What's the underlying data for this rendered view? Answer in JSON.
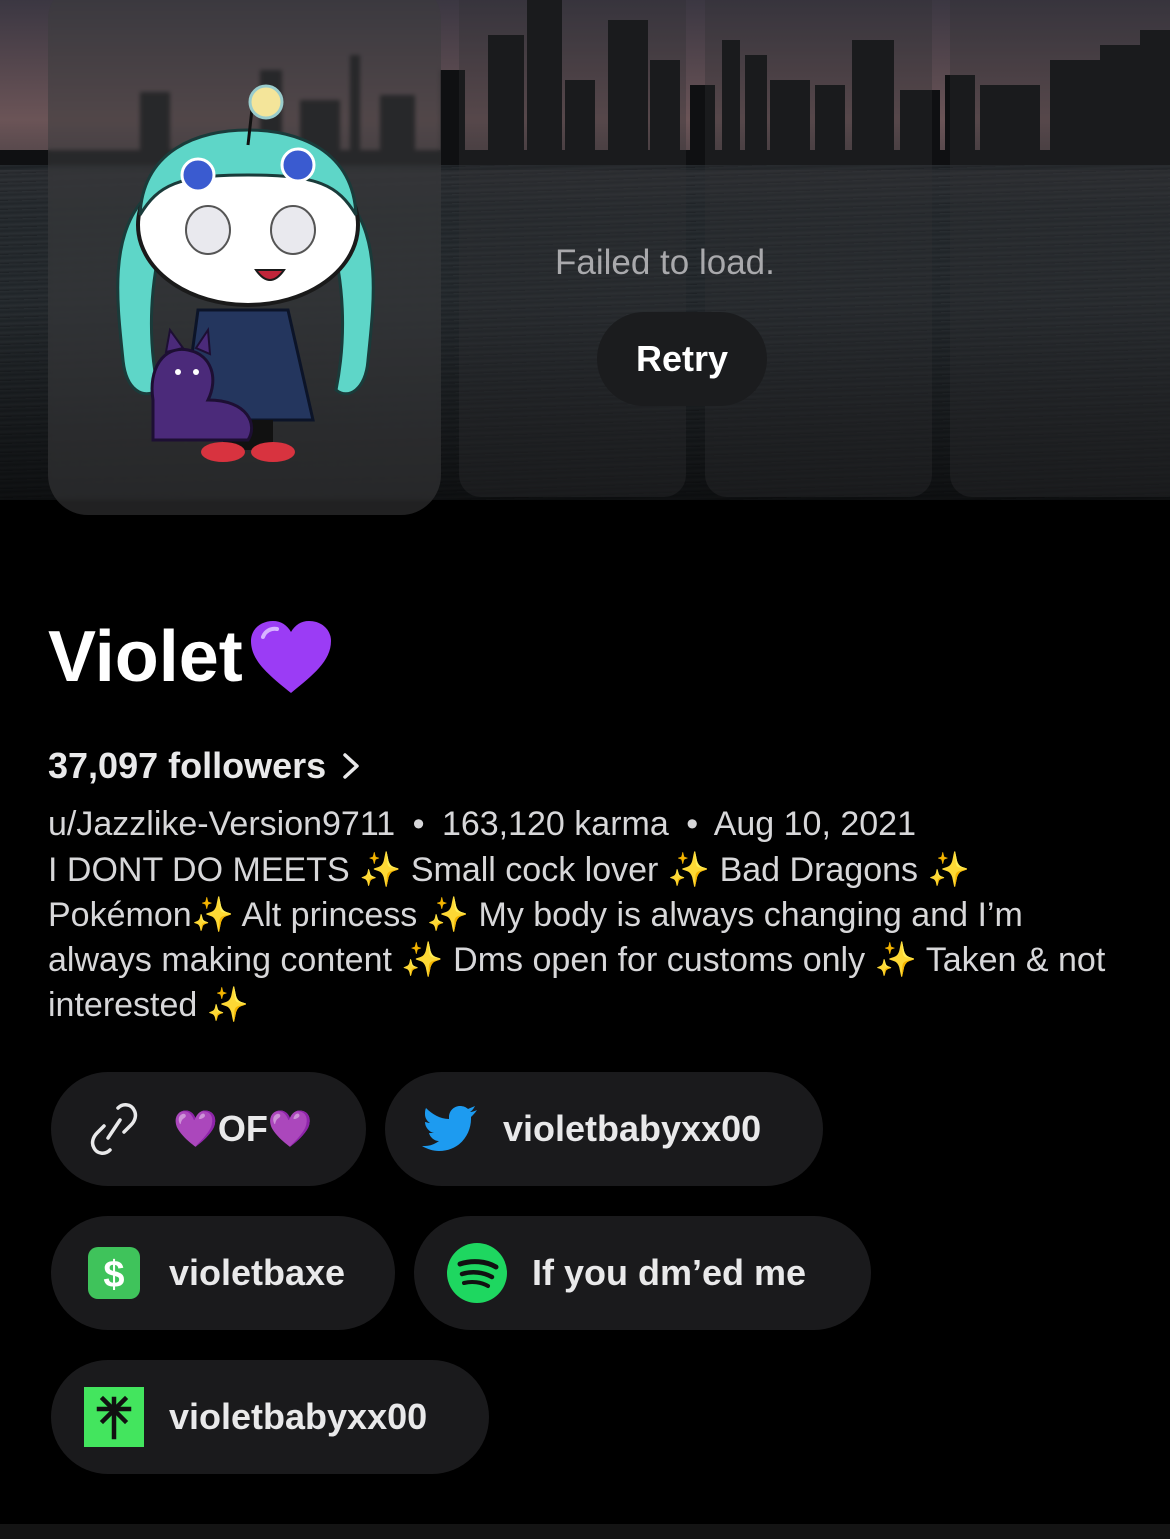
{
  "profile": {
    "display_name": "Violet",
    "name_emoji": "purple-heart",
    "followers_label": "37,097 followers",
    "username": "u/Jazzlike-Version9711",
    "karma": "163,120 karma",
    "joined": "Aug 10, 2021",
    "meta_separator": "•",
    "bio": "I DONT DO MEETS ✨ Small cock lover ✨ Bad Dragons ✨ Pokémon✨ Alt princess ✨ My body is always changing and I’m always making content ✨ Dms open for customs only ✨ Taken & not interested ✨"
  },
  "banner": {
    "failed_text": "Failed to load.",
    "retry_label": "Retry"
  },
  "links": [
    {
      "label": "💜OF💜",
      "icon": "link-icon"
    },
    {
      "label": "violetbabyxx00",
      "icon": "twitter-icon",
      "color": "#1d9bf0"
    },
    {
      "label": "violetbaxe",
      "icon": "cashapp-icon",
      "color": "#3fc35b"
    },
    {
      "label": "If you dm’ed me",
      "icon": "spotify-icon",
      "color": "#1ed760"
    },
    {
      "label": "violetbabyxx00",
      "icon": "linktree-icon",
      "color": "#43e55e"
    }
  ],
  "colors": {
    "background": "#000000",
    "pill": "#1a1a1c",
    "heart": "#9b3cf5"
  }
}
